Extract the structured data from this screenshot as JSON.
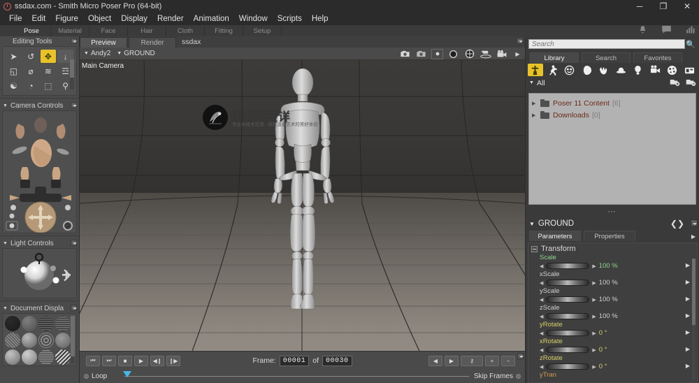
{
  "window": {
    "title": "ssdax.com - Smith Micro Poser Pro  (64-bit)",
    "minimize": "─",
    "maximize": "❐",
    "close": "✕"
  },
  "menubar": [
    "File",
    "Edit",
    "Figure",
    "Object",
    "Display",
    "Render",
    "Animation",
    "Window",
    "Scripts",
    "Help"
  ],
  "room_tabs": [
    {
      "label": "Pose",
      "active": true
    },
    {
      "label": "Material",
      "active": false
    },
    {
      "label": "Face",
      "active": false
    },
    {
      "label": "Hair",
      "active": false
    },
    {
      "label": "Cloth",
      "active": false
    },
    {
      "label": "Fitting",
      "active": false
    },
    {
      "label": "Setup",
      "active": false
    }
  ],
  "room_tabs_right_icons": [
    "bell-icon",
    "comment-icon",
    "chart-icon"
  ],
  "left_panel": {
    "editing_tools": {
      "title": "Editing Tools",
      "tools": [
        {
          "name": "select-tool",
          "glyph": "➤",
          "state": "normal"
        },
        {
          "name": "rotate-tool",
          "glyph": "↺",
          "state": "normal"
        },
        {
          "name": "translate-pull-tool",
          "glyph": "✥",
          "state": "selected"
        },
        {
          "name": "translate-in-out-tool",
          "glyph": "↓",
          "state": "dim"
        },
        {
          "name": "scale-tool",
          "glyph": "◱",
          "state": "normal"
        },
        {
          "name": "taper-tool",
          "glyph": "⌀",
          "state": "normal"
        },
        {
          "name": "twist-tool",
          "glyph": "≋",
          "state": "normal"
        },
        {
          "name": "color-tool",
          "glyph": "☲",
          "state": "normal"
        },
        {
          "name": "morph-tool",
          "glyph": "☯",
          "state": "normal"
        },
        {
          "name": "grouping-tool",
          "glyph": "◔",
          "state": "normal"
        },
        {
          "name": "view-magnifier-tool",
          "glyph": "⬚",
          "state": "normal"
        },
        {
          "name": "zoom-tool",
          "glyph": "⚲",
          "state": "normal"
        }
      ]
    },
    "camera_controls": {
      "title": "Camera Controls"
    },
    "light_controls": {
      "title": "Light Controls"
    },
    "document_display": {
      "title": "Document Displa"
    }
  },
  "document": {
    "tabs": [
      {
        "label": "Preview",
        "active": true
      },
      {
        "label": "Render",
        "active": false
      }
    ],
    "name": "ssdax",
    "actor_selectors": [
      "Andy2",
      "GROUND"
    ],
    "camera_label": "Main Camera",
    "toolbar_icons": [
      "camera-render-icon",
      "camera-area-render-icon",
      "camera-spot-render-icon",
      "sphere-depth-icon",
      "sphere-cross-icon",
      "ground-shadow-icon",
      "movie-camera-icon",
      "more-arrow-icon"
    ],
    "watermark": {
      "title": "伤逝的安详",
      "subtitle": "专业与技术交流 · 成就渲染艺术的美好体验"
    }
  },
  "viewport_bottom": {
    "swatches": [
      "#302e2c",
      "#d8cdb7",
      "#6b4b3c",
      "#e4e1d8"
    ]
  },
  "animation": {
    "transport": [
      {
        "name": "go-to-start-button",
        "glyph": "⏮"
      },
      {
        "name": "go-to-end-button",
        "glyph": "⏭"
      },
      {
        "name": "stop-button",
        "glyph": "■"
      },
      {
        "name": "play-button",
        "glyph": "▶"
      },
      {
        "name": "step-back-button",
        "glyph": "◀❙"
      },
      {
        "name": "step-forward-button",
        "glyph": "❙▶"
      }
    ],
    "frame_label": "Frame:",
    "frame_current": "00001",
    "of_label": "of",
    "frame_total": "00030",
    "right_buttons": [
      {
        "name": "prev-keyframe-button",
        "glyph": "◀"
      },
      {
        "name": "next-keyframe-button",
        "glyph": "▶"
      },
      {
        "name": "key-button",
        "glyph": "⚷"
      },
      {
        "name": "add-keyframe-button",
        "glyph": "+"
      },
      {
        "name": "remove-keyframe-button",
        "glyph": "−"
      }
    ],
    "loop_label": "Loop",
    "skip_frames_label": "Skip Frames"
  },
  "library": {
    "search_placeholder": "Search",
    "search_value": "",
    "tabs": [
      {
        "label": "Library",
        "active": true
      },
      {
        "label": "Search",
        "active": false
      },
      {
        "label": "Favorites",
        "active": false
      }
    ],
    "categories": [
      {
        "name": "figures-category",
        "glyph": "✝",
        "selected": true
      },
      {
        "name": "poses-category",
        "glyph": "Ὣ6",
        "selected": false
      },
      {
        "name": "expressions-category",
        "glyph": "☺",
        "selected": false
      },
      {
        "name": "hair-category",
        "glyph": "◕",
        "selected": false
      },
      {
        "name": "hands-category",
        "glyph": "✋",
        "selected": false
      },
      {
        "name": "props-category",
        "glyph": "⛑",
        "selected": false
      },
      {
        "name": "lights-category",
        "glyph": "Ὂ1",
        "selected": false
      },
      {
        "name": "cameras-category",
        "glyph": "Ἲ5",
        "selected": false
      },
      {
        "name": "materials-category",
        "glyph": "◑",
        "selected": false
      },
      {
        "name": "scenes-category",
        "glyph": "Ὓc",
        "selected": false
      }
    ],
    "filter_label": "All",
    "folder_actions": [
      "add-library-icon",
      "remove-library-icon"
    ],
    "tree": [
      {
        "label": "Poser 11 Content",
        "count": "[6]"
      },
      {
        "label": "Downloads",
        "count": "[0]"
      }
    ]
  },
  "parameters": {
    "title": "GROUND",
    "tabs": [
      {
        "label": "Parameters",
        "active": true
      },
      {
        "label": "Properties",
        "active": false
      }
    ],
    "group": "Transform",
    "dials": [
      {
        "label": "Scale",
        "value": "100 %",
        "color": "#8fd48f"
      },
      {
        "label": "xScale",
        "value": "100 %",
        "color": "#d0d0d0"
      },
      {
        "label": "yScale",
        "value": "100 %",
        "color": "#d0d0d0"
      },
      {
        "label": "zScale",
        "value": "100 %",
        "color": "#d0d0d0"
      },
      {
        "label": "yRotate",
        "value": "0 °",
        "color": "#d8cf6a"
      },
      {
        "label": "xRotate",
        "value": "0 °",
        "color": "#d8cf6a"
      },
      {
        "label": "zRotate",
        "value": "0 °",
        "color": "#d8cf6a"
      },
      {
        "label": "yTran",
        "value": "",
        "color": "#d39a54"
      }
    ]
  }
}
